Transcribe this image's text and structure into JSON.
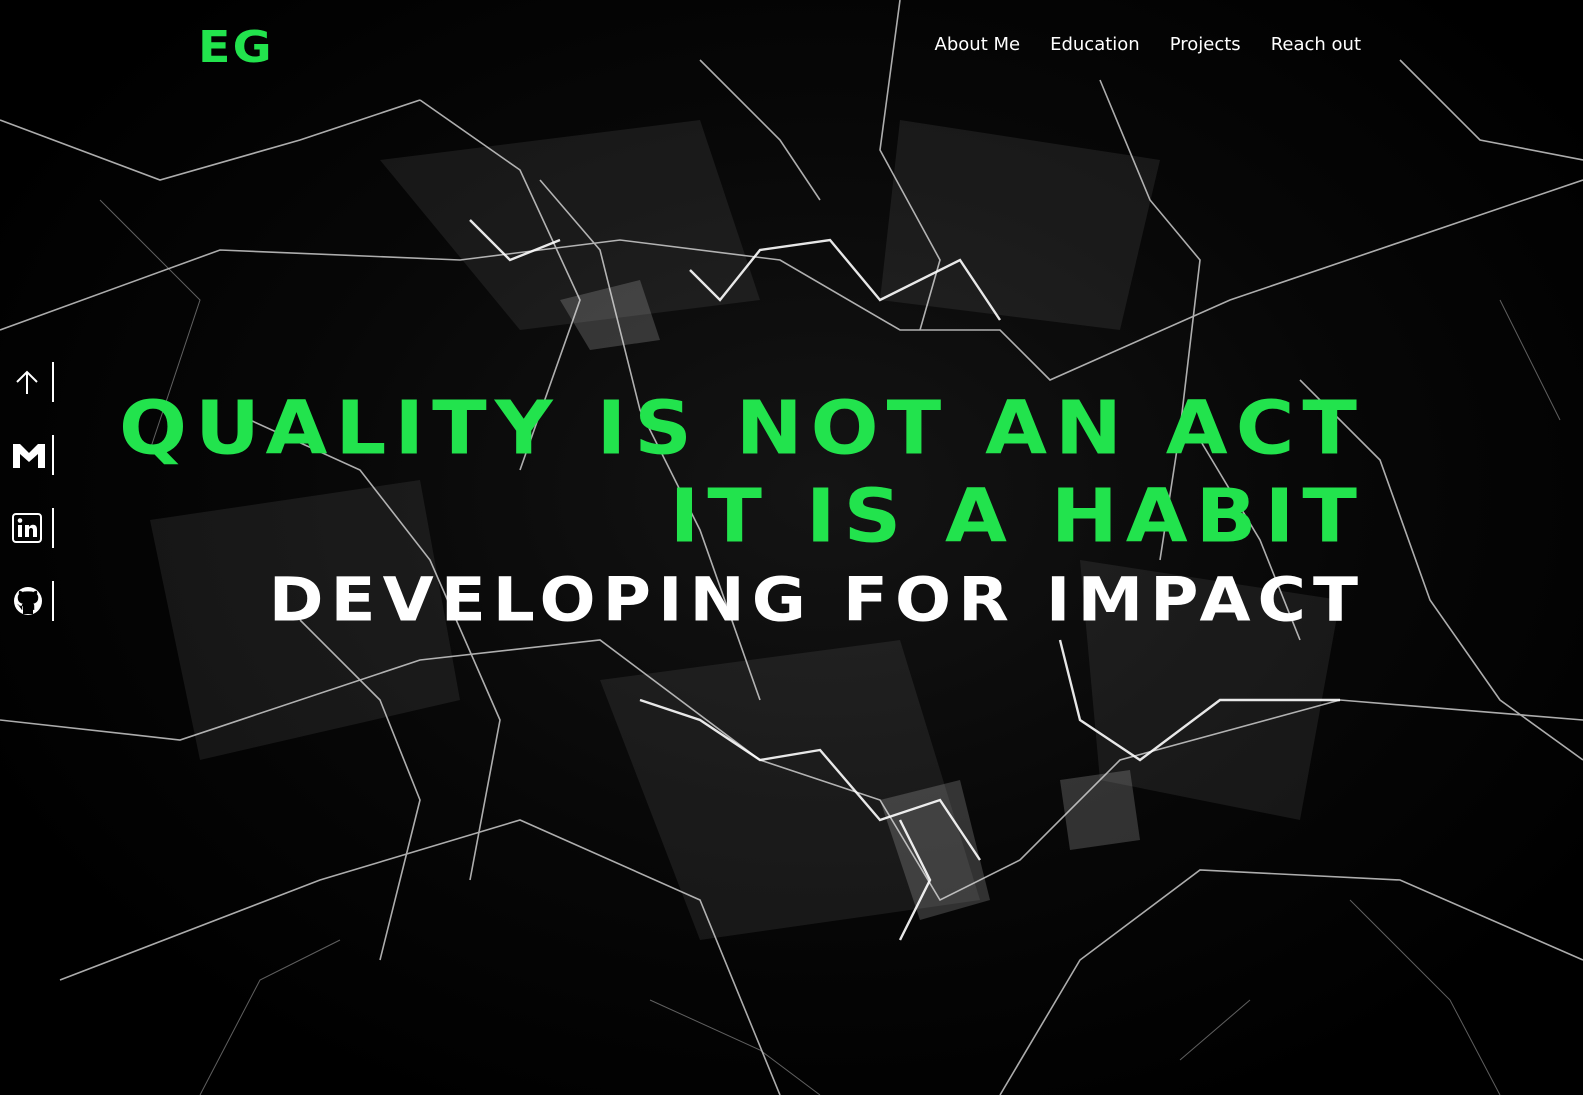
{
  "brand": {
    "logo_text": "EG",
    "accent_color": "#22e34d"
  },
  "nav": {
    "items": [
      {
        "label": "About Me"
      },
      {
        "label": "Education"
      },
      {
        "label": "Projects"
      },
      {
        "label": "Reach out"
      }
    ]
  },
  "social": {
    "items": [
      {
        "icon": "arrow-up-icon"
      },
      {
        "icon": "gmail-icon"
      },
      {
        "icon": "linkedin-icon"
      },
      {
        "icon": "github-icon"
      }
    ]
  },
  "hero": {
    "line1": "QUALITY IS NOT AN ACT",
    "line2": "IT IS A HABIT",
    "line3": "DEVELOPING FOR IMPACT"
  }
}
